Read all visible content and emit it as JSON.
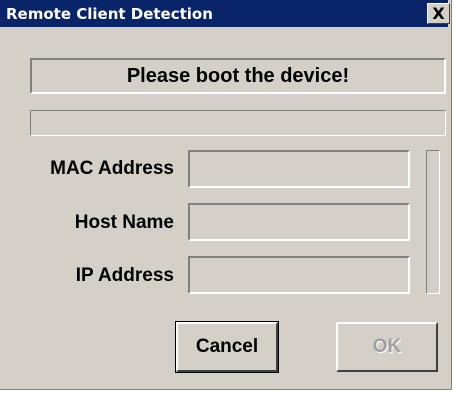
{
  "window": {
    "title": "Remote Client Detection",
    "close_label": "X"
  },
  "status": {
    "message": "Please boot the device!"
  },
  "fields": [
    {
      "label": "MAC Address",
      "value": ""
    },
    {
      "label": "Host Name",
      "value": ""
    },
    {
      "label": "IP Address",
      "value": ""
    }
  ],
  "buttons": {
    "cancel_label": "Cancel",
    "ok_label": "OK",
    "ok_enabled": false
  },
  "colors": {
    "title_bar": "#0a246a",
    "face": "#d4d0c8",
    "disabled_text": "#a0a0a0"
  }
}
